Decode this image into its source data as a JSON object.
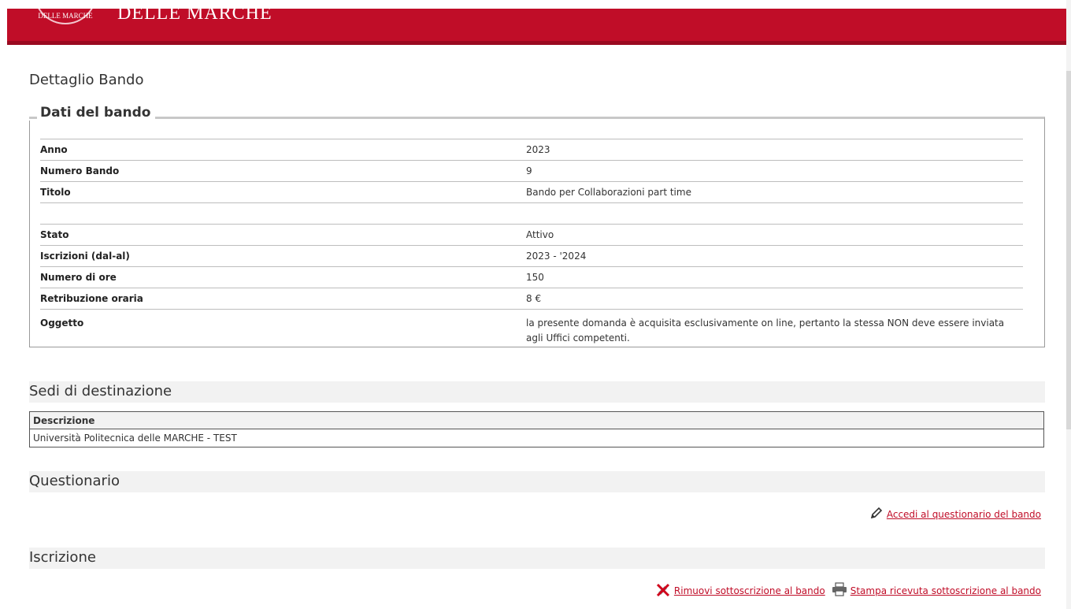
{
  "header": {
    "institution_text": "DELLE MARCHE",
    "seal_text": "DELLE MARCHE"
  },
  "page": {
    "title": "Dettaglio Bando"
  },
  "bando": {
    "legend": "Dati del bando",
    "rows": [
      {
        "label": "Anno",
        "value": "2023"
      },
      {
        "label": "Numero Bando",
        "value": "9"
      },
      {
        "label": "Titolo",
        "value": "Bando per Collaborazioni part time"
      },
      {
        "label": "",
        "value": ""
      },
      {
        "label": "Stato",
        "value": "Attivo"
      },
      {
        "label": "Iscrizioni (dal-al)",
        "value": "2023 - '2024"
      },
      {
        "label": "Numero di ore",
        "value": "150"
      },
      {
        "label": "Retribuzione oraria",
        "value": "8 €"
      },
      {
        "label": "Oggetto",
        "value": "la presente domanda è acquisita esclusivamente on line, pertanto la stessa NON deve essere inviata agli Uffici competenti."
      }
    ]
  },
  "sedi": {
    "title": "Sedi di destinazione",
    "column": "Descrizione",
    "rows": [
      "Università Politecnica delle MARCHE - TEST"
    ]
  },
  "questionario": {
    "title": "Questionario",
    "link": "Accedi al questionario del bando"
  },
  "iscrizione": {
    "title": "Iscrizione",
    "remove_link": "Rimuovi sottoscrizione al bando",
    "print_link": "Stampa ricevuta sottoscrizione al bando"
  },
  "colors": {
    "brand": "#c00d28",
    "section_bg": "#f2f2f2"
  },
  "icons": [
    "pencil-icon",
    "remove-subscription-icon",
    "printer-icon"
  ]
}
